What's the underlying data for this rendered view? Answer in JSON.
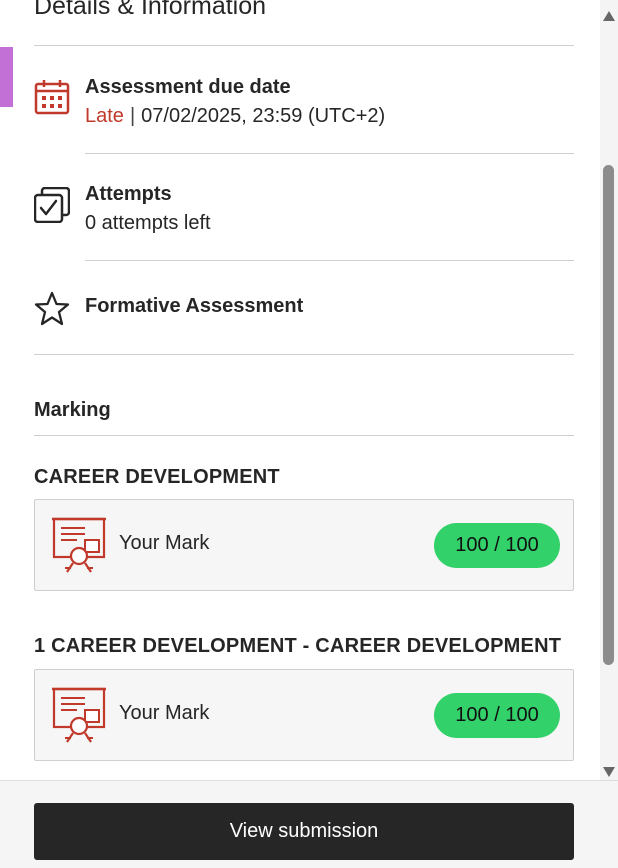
{
  "section": {
    "title": "Details & Information"
  },
  "details": {
    "due_date": {
      "title": "Assessment due date",
      "status": "Late",
      "separator": "|",
      "date": "07/02/2025, 23:59 (UTC+2)",
      "icon": "calendar-icon"
    },
    "attempts": {
      "title": "Attempts",
      "value": "0 attempts left",
      "icon": "attempts-checkbox-icon"
    },
    "formative": {
      "title": "Formative Assessment",
      "icon": "star-icon"
    }
  },
  "marking": {
    "heading": "Marking",
    "groups": [
      {
        "heading": "CAREER DEVELOPMENT",
        "label": "Your Mark",
        "score": "100 / 100",
        "icon": "certificate-icon"
      },
      {
        "heading": "1 CAREER DEVELOPMENT - CAREER DEVELOPMENT",
        "label": "Your Mark",
        "score": "100 / 100",
        "icon": "certificate-icon"
      }
    ]
  },
  "footer": {
    "button_label": "View submission"
  },
  "colors": {
    "late": "#c0392b",
    "score_pill": "#33d16a",
    "accent": "#c26fd6",
    "icon_red": "#c0392b",
    "button": "#262626"
  }
}
